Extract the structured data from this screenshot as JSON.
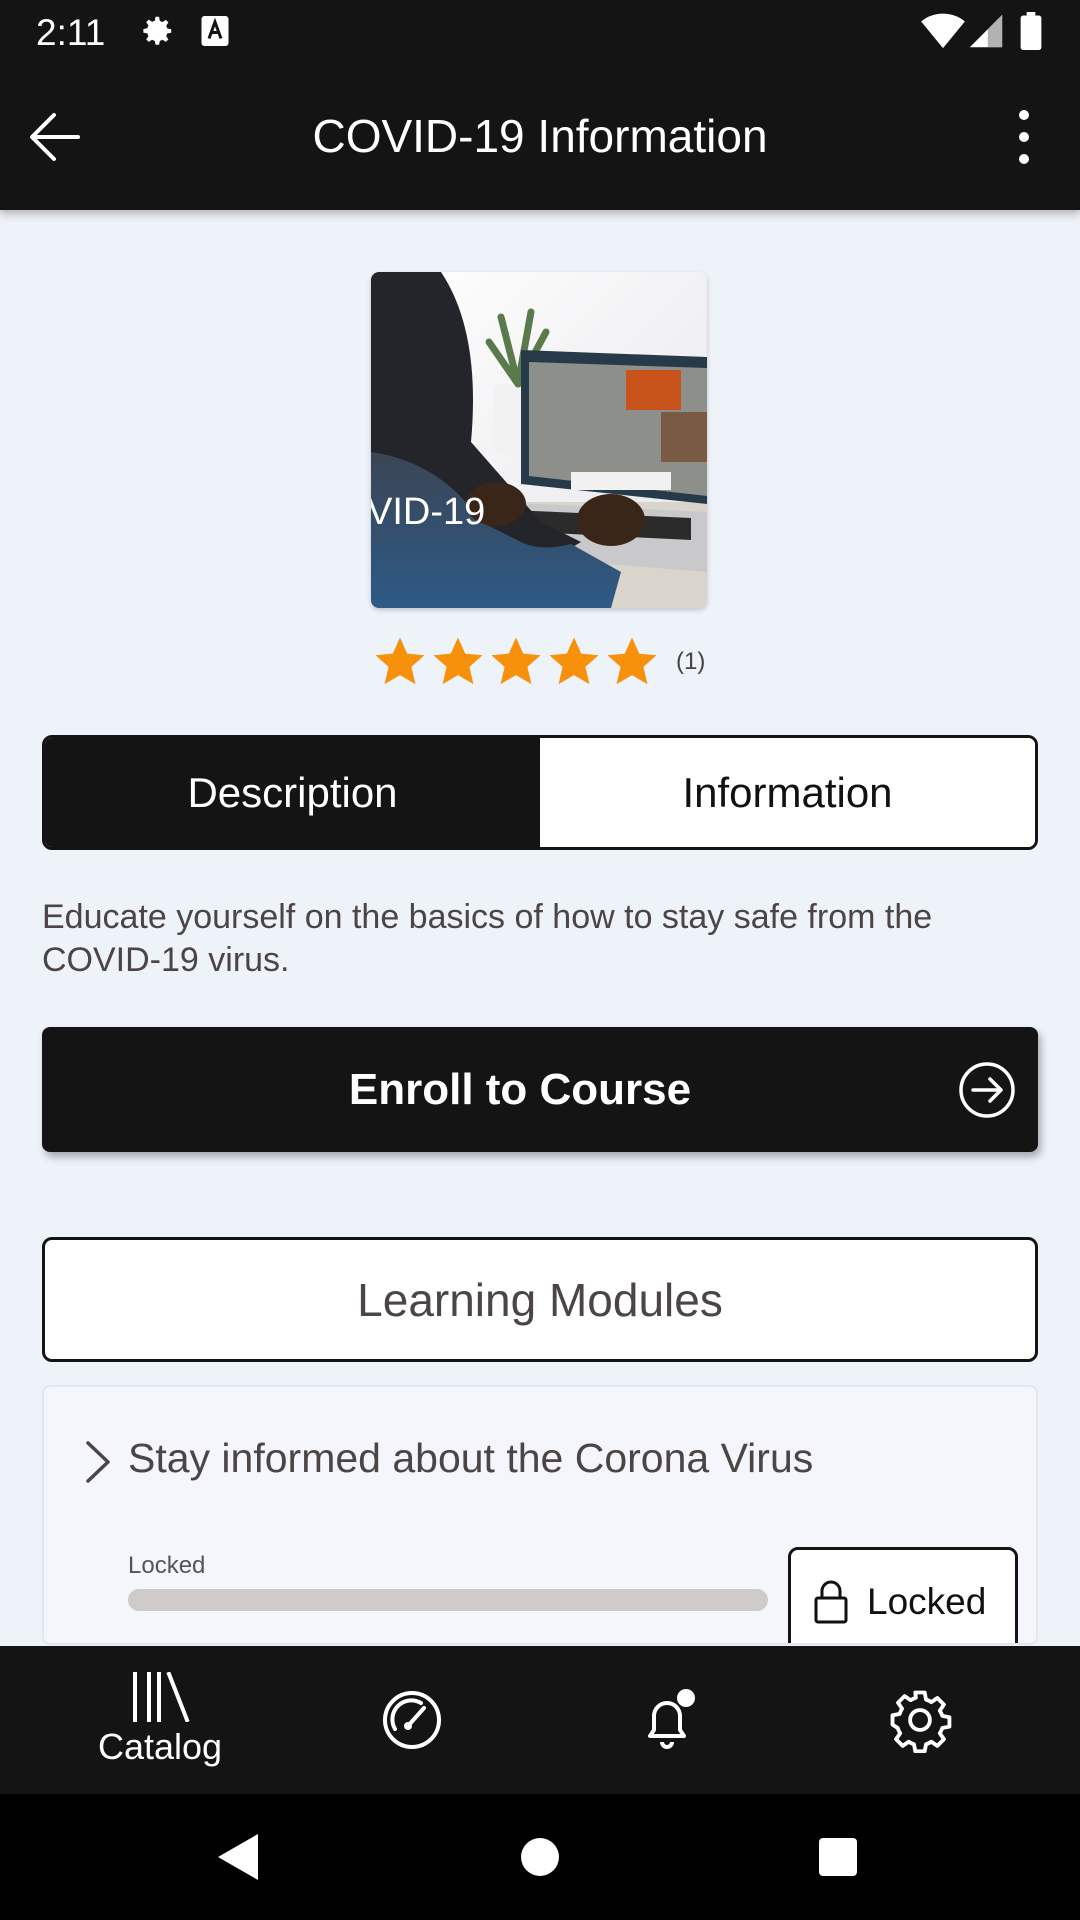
{
  "status_bar": {
    "time": "2:11"
  },
  "app_bar": {
    "title": "COVID-19 Information"
  },
  "course": {
    "image_text": "VID-19",
    "rating_value": 5,
    "rating_max": 5,
    "rating_count": "(1)"
  },
  "tabs": [
    {
      "label": "Description",
      "active": true
    },
    {
      "label": "Information",
      "active": false
    }
  ],
  "description": "Educate yourself on the basics of how to stay safe from the COVID-19 virus.",
  "enroll": {
    "label": "Enroll to Course"
  },
  "modules": {
    "header": "Learning Modules",
    "items": [
      {
        "title": "Stay informed about the Corona Virus",
        "progress_label": "Locked",
        "progress": 0,
        "status_button": "Locked"
      }
    ]
  },
  "bottom_nav": {
    "items": [
      {
        "icon": "catalog-icon",
        "label": "Catalog"
      },
      {
        "icon": "dashboard-icon",
        "label": ""
      },
      {
        "icon": "notification-bell-icon",
        "label": ""
      },
      {
        "icon": "settings-gear-icon",
        "label": ""
      }
    ]
  },
  "colors": {
    "dark": "#141414",
    "background": "#eef2f9",
    "star": "#f7900a",
    "muted_text": "#4b4545"
  }
}
